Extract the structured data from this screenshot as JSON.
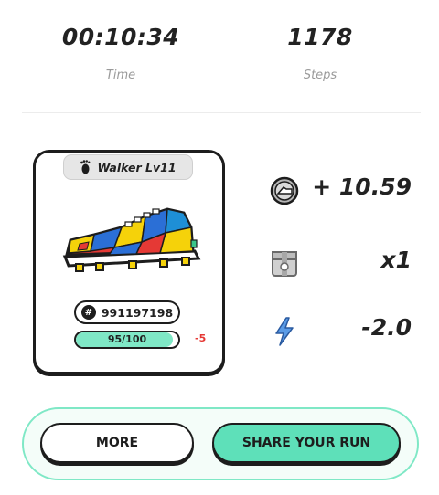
{
  "stats": {
    "time_value": "00:10:34",
    "time_label": "Time",
    "steps_value": "1178",
    "steps_label": "Steps"
  },
  "sneaker_card": {
    "type_label": "Walker Lv11",
    "type_icon": "footprint-icon",
    "id": "991197198",
    "id_icon": "hash-icon",
    "durability_text": "95/100",
    "durability_fraction": 0.95,
    "durability_delta": "-5"
  },
  "rewards": {
    "earnings_value": "+ 10.59",
    "earnings_icon": "gst-coin-icon",
    "multiplier_value": "x1",
    "multiplier_icon": "mystery-box-icon",
    "energy_value": "-2.0",
    "energy_icon": "lightning-bolt-icon"
  },
  "actions": {
    "more_label": "MORE",
    "share_label": "SHARE YOUR RUN"
  },
  "colors": {
    "accent": "#5ee0b9",
    "accent_light": "#7fe8c6",
    "penalty": "#e53935",
    "energy": "#5a9be6"
  }
}
